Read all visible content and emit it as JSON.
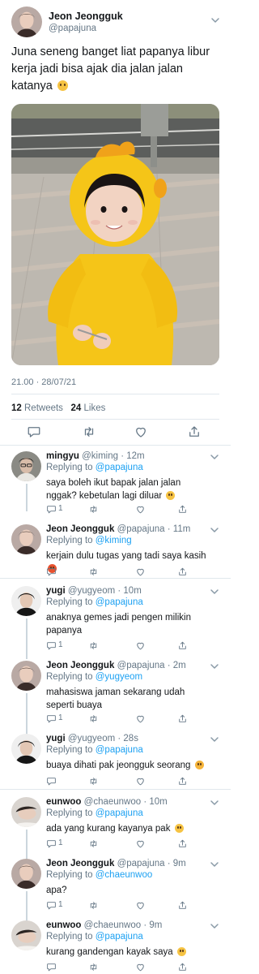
{
  "main_tweet": {
    "author_name": "Jeon Jeongguk",
    "author_handle": "@papajuna",
    "text": "Juna seneng banget liat papanya libur kerja jadi bisa ajak dia jalan jalan katanya",
    "timestamp": "21.00 · 28/07/21",
    "retweets_count": "12",
    "retweets_label": "Retweets",
    "likes_count": "24",
    "likes_label": "Likes",
    "icons": [
      "comment-icon",
      "retweet-icon",
      "like-icon",
      "share-icon"
    ]
  },
  "replies": [
    {
      "name": "mingyu",
      "meta": "@kiming · 12m",
      "replying_prefix": "Replying to",
      "replying_to": "@papajuna",
      "text": "saya boleh ikut bapak jalan jalan nggak? kebetulan lagi diluar",
      "reply_count": "1"
    },
    {
      "name": "Jeon Jeongguk",
      "meta": "@papajuna · 11m",
      "replying_prefix": "Replying to",
      "replying_to": "@kiming",
      "text": "kerjain dulu tugas yang tadi saya kasih",
      "reply_count": ""
    },
    {
      "name": "yugi",
      "meta": "@yugyeom · 10m",
      "replying_prefix": "Replying to",
      "replying_to": "@papajuna",
      "text": "anaknya gemes jadi pengen milikin papanya",
      "reply_count": "1"
    },
    {
      "name": "Jeon Jeongguk",
      "meta": "@papajuna · 2m",
      "replying_prefix": "Replying to",
      "replying_to": "@yugyeom",
      "text": "mahasiswa jaman sekarang udah seperti buaya",
      "reply_count": "1"
    },
    {
      "name": "yugi",
      "meta": "@yugyeom · 28s",
      "replying_prefix": "Replying to",
      "replying_to": "@papajuna",
      "text": "buaya dihati pak jeongguk seorang",
      "reply_count": ""
    },
    {
      "name": "eunwoo",
      "meta": "@chaeunwoo · 10m",
      "replying_prefix": "Replying to",
      "replying_to": "@papajuna",
      "text": "ada yang kurang kayanya pak",
      "reply_count": "1"
    },
    {
      "name": "Jeon Jeongguk",
      "meta": "@papajuna · 9m",
      "replying_prefix": "Replying to",
      "replying_to": "@chaeunwoo",
      "text": "apa?",
      "reply_count": "1"
    },
    {
      "name": "eunwoo",
      "meta": "@chaeunwoo · 9m",
      "replying_prefix": "Replying to",
      "replying_to": "@papajuna",
      "text": "kurang gandengan kayak saya",
      "reply_count": ""
    }
  ],
  "colors": {
    "text": "#14171a",
    "secondary": "#657786",
    "link": "#1da1f2",
    "divider": "#e1e8ed",
    "thread_line": "#ccd6dd",
    "hoodie_yellow": "#f5c518"
  }
}
